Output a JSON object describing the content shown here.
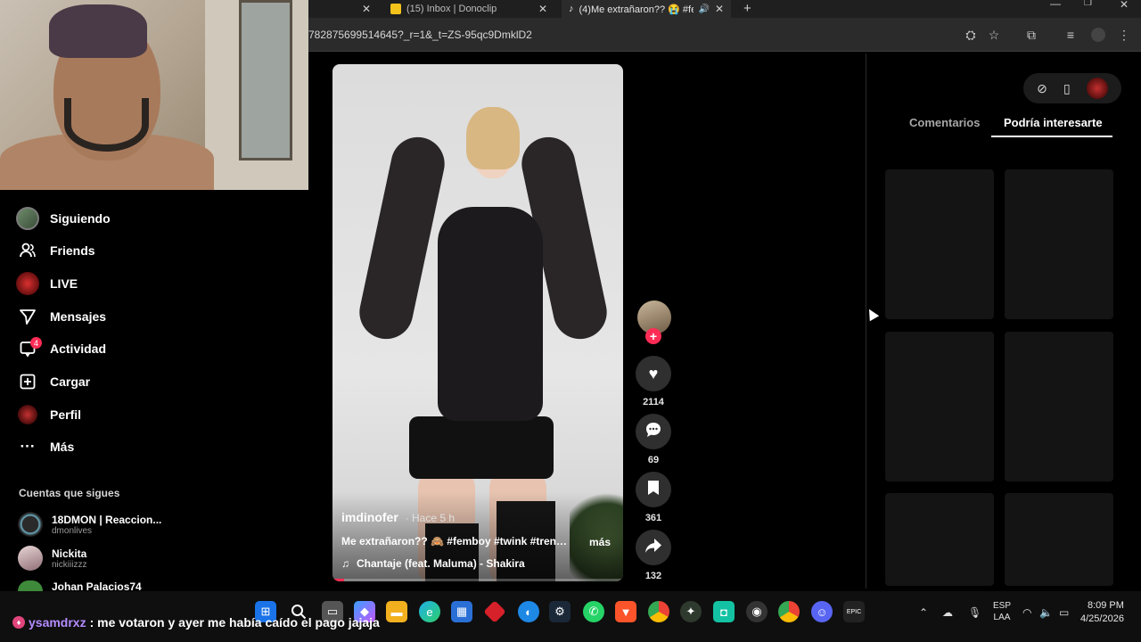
{
  "browser": {
    "tabs": [
      {
        "title": "(15) Inbox | Donoclip"
      },
      {
        "title": "(4)Me extrañaron?? 😭 #fer"
      }
    ],
    "url": "782875699514645?_r=1&_t=ZS-95qc9DmklD2"
  },
  "nav": {
    "items": [
      {
        "label": "Siguiendo",
        "icon": "following-avatar-icon"
      },
      {
        "label": "Friends",
        "icon": "friends-icon"
      },
      {
        "label": "LIVE",
        "icon": "live-icon"
      },
      {
        "label": "Mensajes",
        "icon": "messages-icon"
      },
      {
        "label": "Actividad",
        "icon": "activity-icon",
        "badge": "4"
      },
      {
        "label": "Cargar",
        "icon": "upload-icon"
      },
      {
        "label": "Perfil",
        "icon": "profile-icon"
      },
      {
        "label": "Más",
        "icon": "more-icon"
      }
    ]
  },
  "following": {
    "title": "Cuentas que sigues",
    "accounts": [
      {
        "name": "18DMON | Reaccion...",
        "handle": "dmonlives"
      },
      {
        "name": "Nickita",
        "handle": "nickiiizzz"
      },
      {
        "name": "Johan Palacios74",
        "handle": ""
      }
    ]
  },
  "video": {
    "author": "imdinofer",
    "time": "· Hace 5 h",
    "caption": "Me extrañaron?? 🙈 #femboy #twink #trend ...",
    "more": "más",
    "music": "Chantaje (feat. Maluma) - Shakira",
    "progress": 0.04
  },
  "actions": {
    "likes": "2114",
    "comments": "69",
    "saves": "361",
    "shares": "132"
  },
  "right_panel": {
    "tabs": [
      "Comentarios",
      "Podría interesarte"
    ],
    "active_tab": "Podría interesarte"
  },
  "chat": {
    "user": "ysamdrxz",
    "message": ": me votaron y ayer me había caído el pago jajaja"
  },
  "tray": {
    "lang_top": "ESP",
    "lang_bottom": "LAA",
    "time": "8:09 PM",
    "date": "4/25/2026"
  },
  "colors": {
    "accent": "#fe2c55",
    "background": "#000000"
  }
}
